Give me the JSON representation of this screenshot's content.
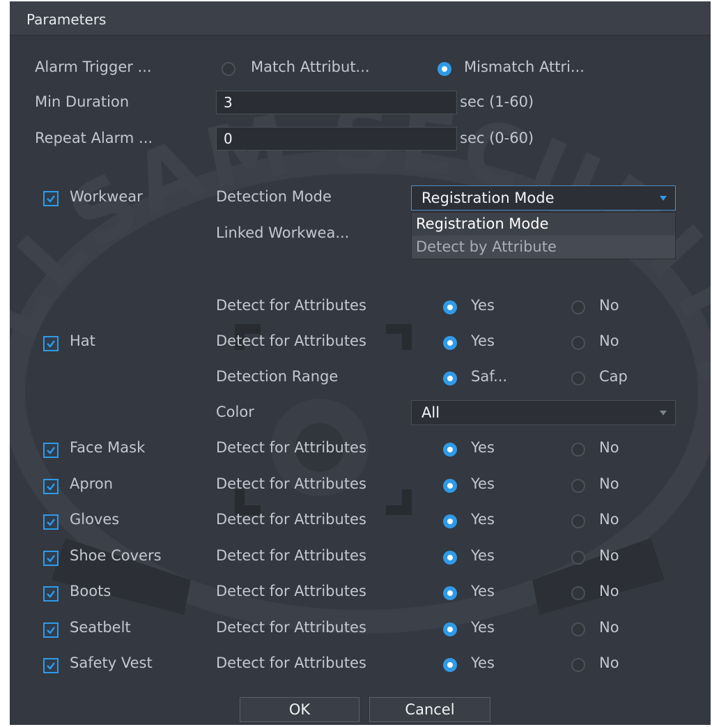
{
  "dialog": {
    "title": "Parameters"
  },
  "alarm_trigger": {
    "label": "Alarm Trigger ...",
    "options": [
      "Match Attribut...",
      "Mismatch Attri..."
    ],
    "selected_index": 1
  },
  "min_duration": {
    "label": "Min Duration",
    "value": "3",
    "unit": "sec (1-60)"
  },
  "repeat_alarm": {
    "label": "Repeat Alarm ...",
    "value": "0",
    "unit": "sec (0-60)"
  },
  "workwear": {
    "label": "Workwear",
    "checked": true,
    "detection_mode_label": "Detection Mode",
    "detection_mode_value": "Registration Mode",
    "dropdown_options": [
      "Registration Mode",
      "Detect by Attribute"
    ],
    "linked_label": "Linked Workwea...",
    "detect_label": "Detect for Attributes",
    "yes": "Yes",
    "no": "No"
  },
  "hat": {
    "label": "Hat",
    "checked": true,
    "detect_label": "Detect for Attributes",
    "yes": "Yes",
    "no": "No",
    "range_label": "Detection Range",
    "range_opt1": "Saf...",
    "range_opt2": "Cap",
    "color_label": "Color",
    "color_value": "All"
  },
  "items": [
    {
      "label": "Face Mask",
      "checked": true,
      "detect_label": "Detect for Attributes",
      "yes": "Yes",
      "no": "No"
    },
    {
      "label": "Apron",
      "checked": true,
      "detect_label": "Detect for Attributes",
      "yes": "Yes",
      "no": "No"
    },
    {
      "label": "Gloves",
      "checked": true,
      "detect_label": "Detect for Attributes",
      "yes": "Yes",
      "no": "No"
    },
    {
      "label": "Shoe Covers",
      "checked": true,
      "detect_label": "Detect for Attributes",
      "yes": "Yes",
      "no": "No"
    },
    {
      "label": "Boots",
      "checked": true,
      "detect_label": "Detect for Attributes",
      "yes": "Yes",
      "no": "No"
    },
    {
      "label": "Seatbelt",
      "checked": true,
      "detect_label": "Detect for Attributes",
      "yes": "Yes",
      "no": "No"
    },
    {
      "label": "Safety Vest",
      "checked": true,
      "detect_label": "Detect for Attributes",
      "yes": "Yes",
      "no": "No"
    }
  ],
  "footer": {
    "ok_label": "OK",
    "cancel_label": "Cancel"
  },
  "watermark": {
    "text": "LLSAM SECURITY"
  },
  "colors": {
    "accent": "#2f9be8",
    "background": "#343840"
  }
}
